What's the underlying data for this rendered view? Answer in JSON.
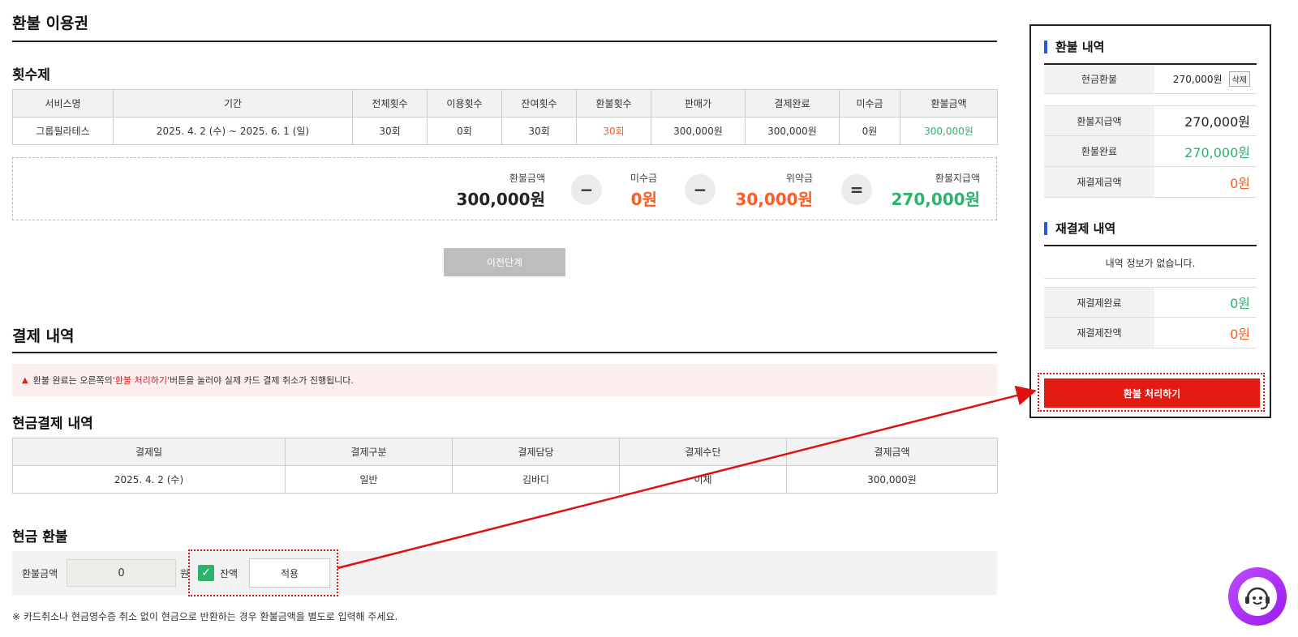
{
  "page_title": "환불 이용권",
  "count_section": {
    "title": "횟수제",
    "headers": [
      "서비스명",
      "기간",
      "전체횟수",
      "이용횟수",
      "잔여횟수",
      "환불횟수",
      "판매가",
      "결제완료",
      "미수금",
      "환불금액"
    ],
    "row": [
      "그룹필라테스",
      "2025. 4. 2 (수) ~ 2025. 6. 1 (일)",
      "30회",
      "0회",
      "30회",
      "30회",
      "300,000원",
      "300,000원",
      "0원",
      "300,000원"
    ]
  },
  "calc": {
    "refund_amount_label": "환불금액",
    "refund_amount_value": "300,000원",
    "op1": "−",
    "unpaid_label": "미수금",
    "unpaid_value": "0원",
    "op2": "−",
    "penalty_label": "위약금",
    "penalty_value": "30,000원",
    "op3": "=",
    "payout_label": "환불지급액",
    "payout_value": "270,000원"
  },
  "prev_button": "이전단계",
  "payment_section": {
    "title": "결제 내역",
    "notice_prefix": "환불 완료는 오른쪽의 ",
    "notice_highlight": "'환불 처리하기'",
    "notice_suffix": " 버튼을 눌러야 실제 카드 결제 취소가 진행됩니다.",
    "cash_title": "현금결제 내역",
    "headers": [
      "결제일",
      "결제구분",
      "결제담당",
      "결제수단",
      "결제금액"
    ],
    "row": [
      "2025. 4. 2 (수)",
      "일반",
      "김바디",
      "이체",
      "300,000원"
    ]
  },
  "cash_refund": {
    "title": "현금 환불",
    "amount_label": "환불금액",
    "amount_value": "0",
    "unit": "원",
    "balance_label": "잔액",
    "apply_button": "적용",
    "footnote": "※ 카드취소나 현금영수증 취소 없이 현금으로 반환하는 경우 환불금액을 별도로 입력해 주세요."
  },
  "side": {
    "refund_title": "환불 내역",
    "cash_refund_label": "현금환불",
    "cash_refund_value": "270,000원",
    "delete_tag": "삭제",
    "payout_label": "환불지급액",
    "payout_value": "270,000원",
    "completed_label": "환불완료",
    "completed_value": "270,000원",
    "repay_amount_label": "재결제금액",
    "repay_amount_value": "0원",
    "repay_title": "재결제 내역",
    "empty_message": "내역 정보가 없습니다.",
    "repay_done_label": "재결제완료",
    "repay_done_value": "0원",
    "repay_balance_label": "재결제잔액",
    "repay_balance_value": "0원",
    "process_button": "환불 처리하기"
  },
  "colors": {
    "accent_red": "#e21b12",
    "orange": "#ff5a1f",
    "green": "#2bb36b",
    "blue": "#2a5bd7"
  }
}
